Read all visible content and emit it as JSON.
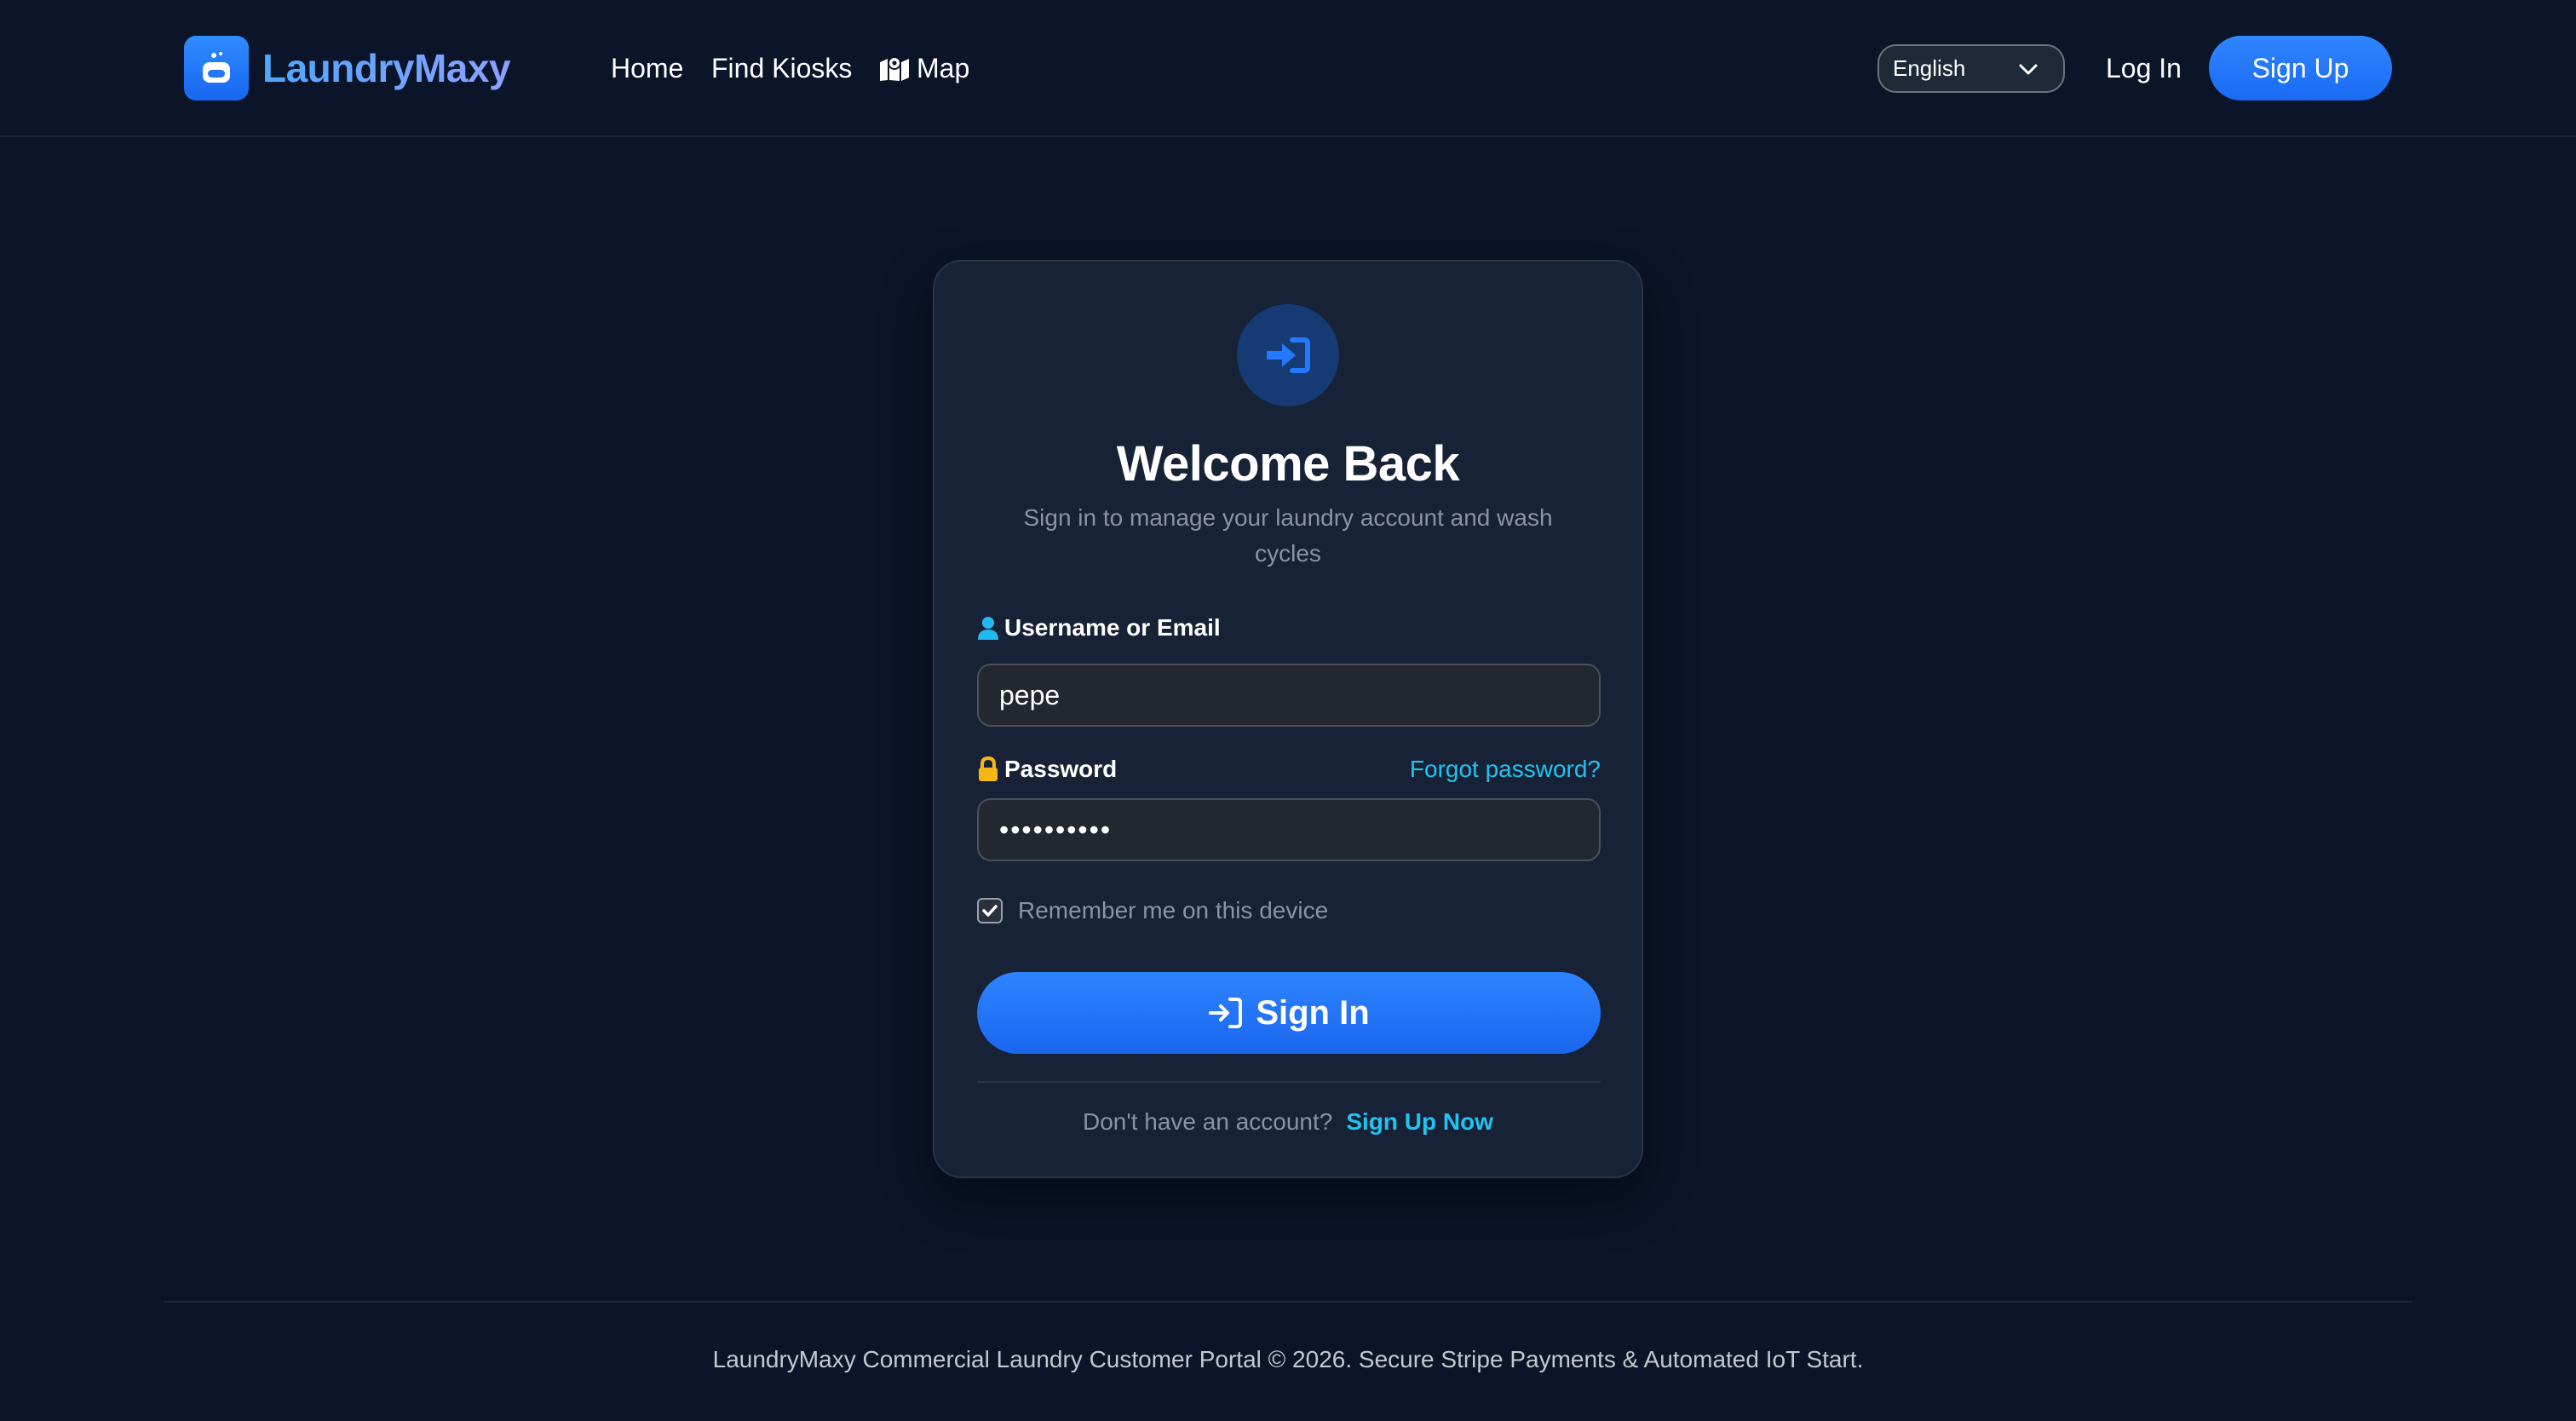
{
  "navbar": {
    "brand_name": "LaundryMaxy",
    "brand_icon": "washing-machine-icon",
    "links": {
      "home": "Home",
      "find_kiosks": "Find Kiosks",
      "map": "Map"
    },
    "map_icon": "map-marked-icon",
    "language": "English",
    "login_label": "Log In",
    "signup_label": "Sign Up"
  },
  "login_card": {
    "header_icon": "sign-in-icon",
    "title": "Welcome Back",
    "subtitle": "Sign in to manage your laundry account and wash cycles",
    "username_label": "Username or Email",
    "username_value": "pepe",
    "password_label": "Password",
    "password_value": "••••••••••",
    "forgot_password": "Forgot password?",
    "remember_me": "Remember me on this device",
    "remember_checked": true,
    "signin_label": "Sign In",
    "no_account_prompt": "Don't have an account?",
    "signup_now": "Sign Up Now"
  },
  "footer": {
    "text": "LaundryMaxy Commercial Laundry Customer Portal © 2026. Secure Stripe Payments & Automated IoT Start."
  },
  "colors": {
    "background": "#0b1428",
    "card": "#172236",
    "primary": "#1a6af3",
    "link": "#22c3f0",
    "muted": "#8b93a3"
  }
}
